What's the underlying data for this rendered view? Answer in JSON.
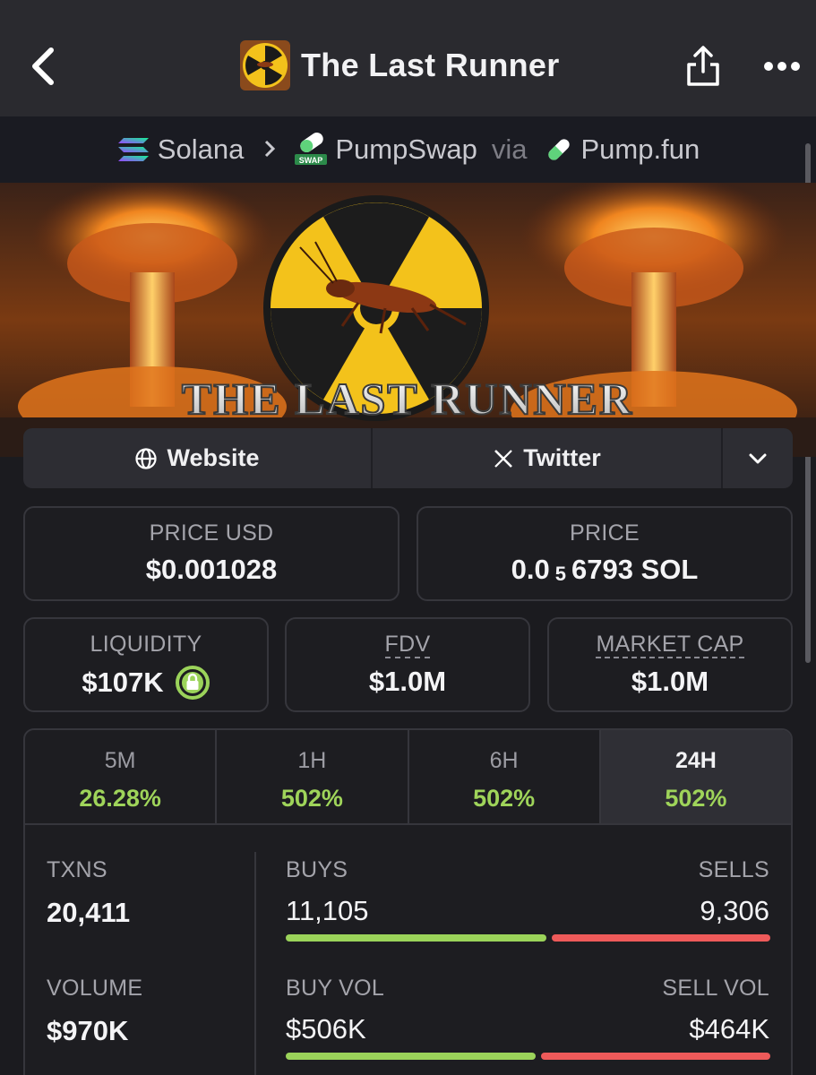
{
  "header": {
    "title": "The Last Runner"
  },
  "breadcrumb": {
    "chain": "Solana",
    "dex": "PumpSwap",
    "via": "via",
    "launchpad": "Pump.fun"
  },
  "banner": {
    "text": "THE LAST RUNNER"
  },
  "links": {
    "website": "Website",
    "twitter": "Twitter"
  },
  "stats": {
    "price_usd_label": "PRICE USD",
    "price_usd_value": "$0.001028",
    "price_label": "PRICE",
    "price_prefix": "0.0",
    "price_sub": "5",
    "price_suffix": "6793 SOL",
    "liquidity_label": "LIQUIDITY",
    "liquidity_value": "$107K",
    "fdv_label": "FDV",
    "fdv_value": "$1.0M",
    "mcap_label": "MARKET CAP",
    "mcap_value": "$1.0M"
  },
  "periods": [
    {
      "label": "5M",
      "value": "26.28%"
    },
    {
      "label": "1H",
      "value": "502%"
    },
    {
      "label": "6H",
      "value": "502%"
    },
    {
      "label": "24H",
      "value": "502%"
    }
  ],
  "txns": {
    "txns_label": "TXNS",
    "txns_value": "20,411",
    "buys_label": "BUYS",
    "buys_value": "11,105",
    "sells_label": "SELLS",
    "sells_value": "9,306",
    "buy_share": 0.544,
    "volume_label": "VOLUME",
    "volume_value": "$970K",
    "buy_vol_label": "BUY VOL",
    "buy_vol_value": "$506K",
    "sell_vol_label": "SELL VOL",
    "sell_vol_value": "$464K",
    "buy_vol_share": 0.522
  },
  "colors": {
    "positive": "#9bd35a",
    "negative": "#ee5a5a",
    "background": "#1b1b1f"
  }
}
